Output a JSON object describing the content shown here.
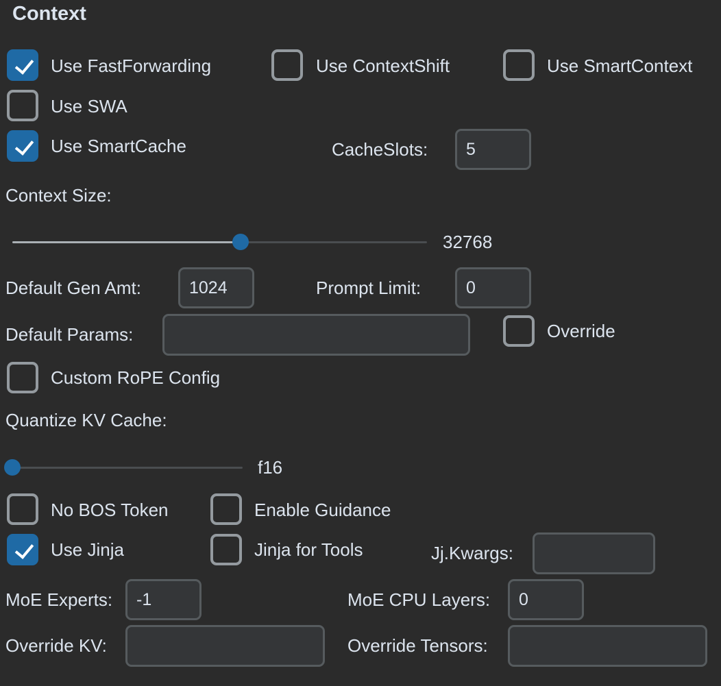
{
  "section": {
    "title": "Context"
  },
  "checkboxes": {
    "fastforwarding": {
      "label": "Use FastForwarding",
      "checked": true
    },
    "contextshift": {
      "label": "Use ContextShift",
      "checked": false
    },
    "smartcontext": {
      "label": "Use SmartContext",
      "checked": false
    },
    "swa": {
      "label": "Use SWA",
      "checked": false
    },
    "smartcache": {
      "label": "Use SmartCache",
      "checked": true
    },
    "override": {
      "label": "Override",
      "checked": false
    },
    "custom_rope": {
      "label": "Custom RoPE Config",
      "checked": false
    },
    "no_bos": {
      "label": "No BOS Token",
      "checked": false
    },
    "guidance": {
      "label": "Enable Guidance",
      "checked": false
    },
    "jinja": {
      "label": "Use Jinja",
      "checked": true
    },
    "jinja_tools": {
      "label": "Jinja for Tools",
      "checked": false
    }
  },
  "fields": {
    "cache_slots": {
      "label": "CacheSlots:",
      "value": "5"
    },
    "gen_amt": {
      "label": "Default Gen Amt:",
      "value": "1024"
    },
    "prompt_limit": {
      "label": "Prompt Limit:",
      "value": "0"
    },
    "default_params": {
      "label": "Default Params:",
      "value": ""
    },
    "jj_kwargs": {
      "label": "Jj.Kwargs:",
      "value": ""
    },
    "moe_experts": {
      "label": "MoE Experts:",
      "value": "-1"
    },
    "moe_cpu_layers": {
      "label": "MoE CPU Layers:",
      "value": "0"
    },
    "override_kv": {
      "label": "Override KV:",
      "value": ""
    },
    "override_tensors": {
      "label": "Override Tensors:",
      "value": ""
    }
  },
  "sliders": {
    "context_size": {
      "label": "Context Size:",
      "value_text": "32768",
      "fraction": 0.55
    },
    "quantize_kv": {
      "label": "Quantize KV Cache:",
      "value_text": "f16",
      "fraction": 0.0
    }
  },
  "colors": {
    "accent": "#1f6aa5",
    "background": "#2b2b2b",
    "entry_border": "#565b5e",
    "text": "#dce4ee"
  }
}
